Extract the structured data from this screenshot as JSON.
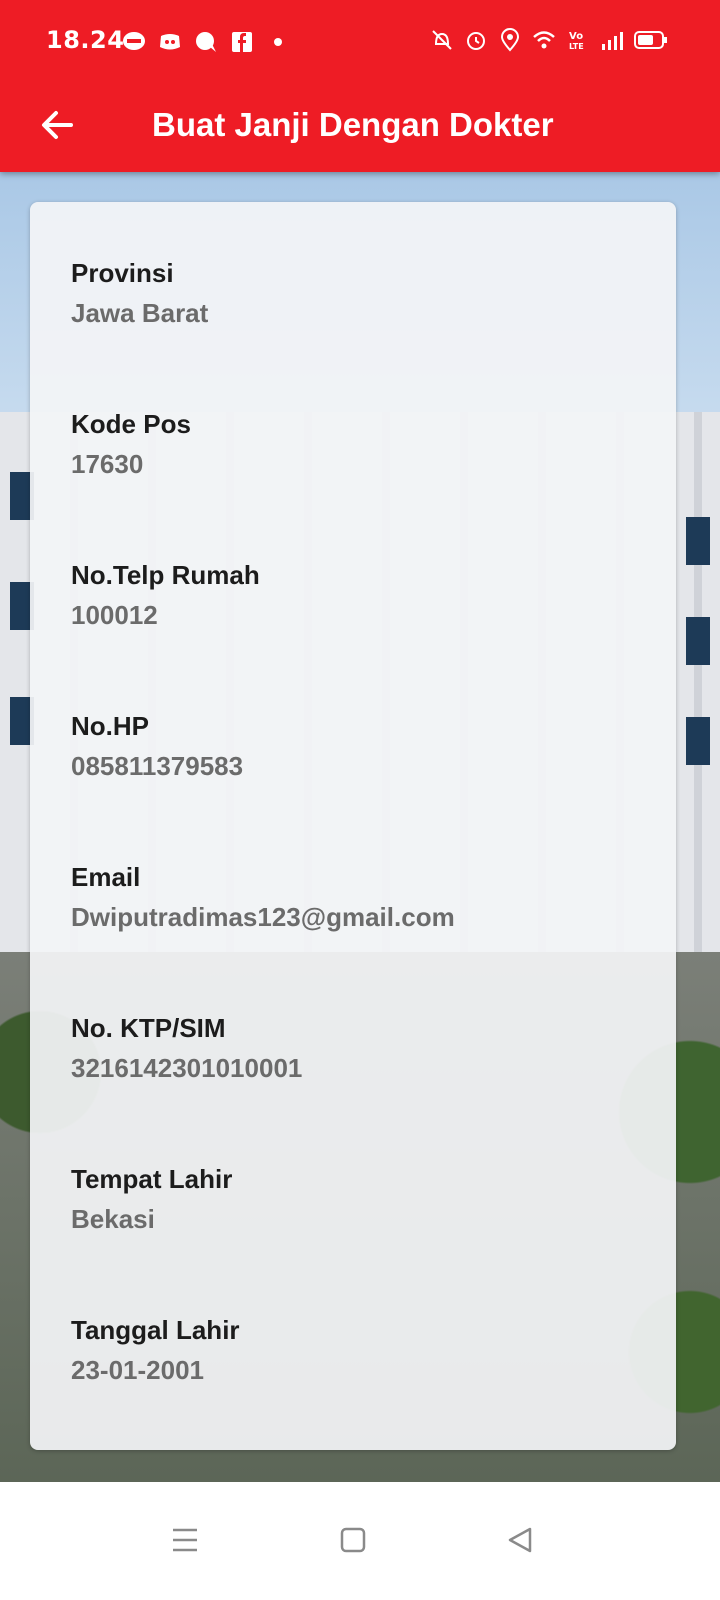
{
  "status": {
    "time": "18.24",
    "icons_left": [
      "line-icon",
      "discord-icon",
      "chat-bubble-icon",
      "facebook-icon",
      "dot-icon"
    ],
    "icons_right": [
      "vibrate-icon",
      "alarm-icon",
      "location-icon",
      "wifi-icon",
      "volte-icon",
      "signal-icon",
      "battery-icon"
    ]
  },
  "appbar": {
    "title": "Buat Janji Dengan Dokter",
    "back_icon": "arrow-left-icon"
  },
  "colors": {
    "primary": "#ee1c25",
    "label": "#1c1c1c",
    "value": "#6b6b6b"
  },
  "fields": [
    {
      "label": "Provinsi",
      "value": "Jawa Barat"
    },
    {
      "label": "Kode Pos",
      "value": "17630"
    },
    {
      "label": "No.Telp Rumah",
      "value": "100012"
    },
    {
      "label": "No.HP",
      "value": "085811379583"
    },
    {
      "label": "Email",
      "value": "Dwiputradimas123@gmail.com"
    },
    {
      "label": "No. KTP/SIM",
      "value": "3216142301010001"
    },
    {
      "label": "Tempat Lahir",
      "value": "Bekasi"
    },
    {
      "label": "Tanggal Lahir",
      "value": "23-01-2001"
    }
  ],
  "navbar": {
    "icons": [
      "menu-icon",
      "home-square-icon",
      "back-triangle-icon"
    ]
  }
}
